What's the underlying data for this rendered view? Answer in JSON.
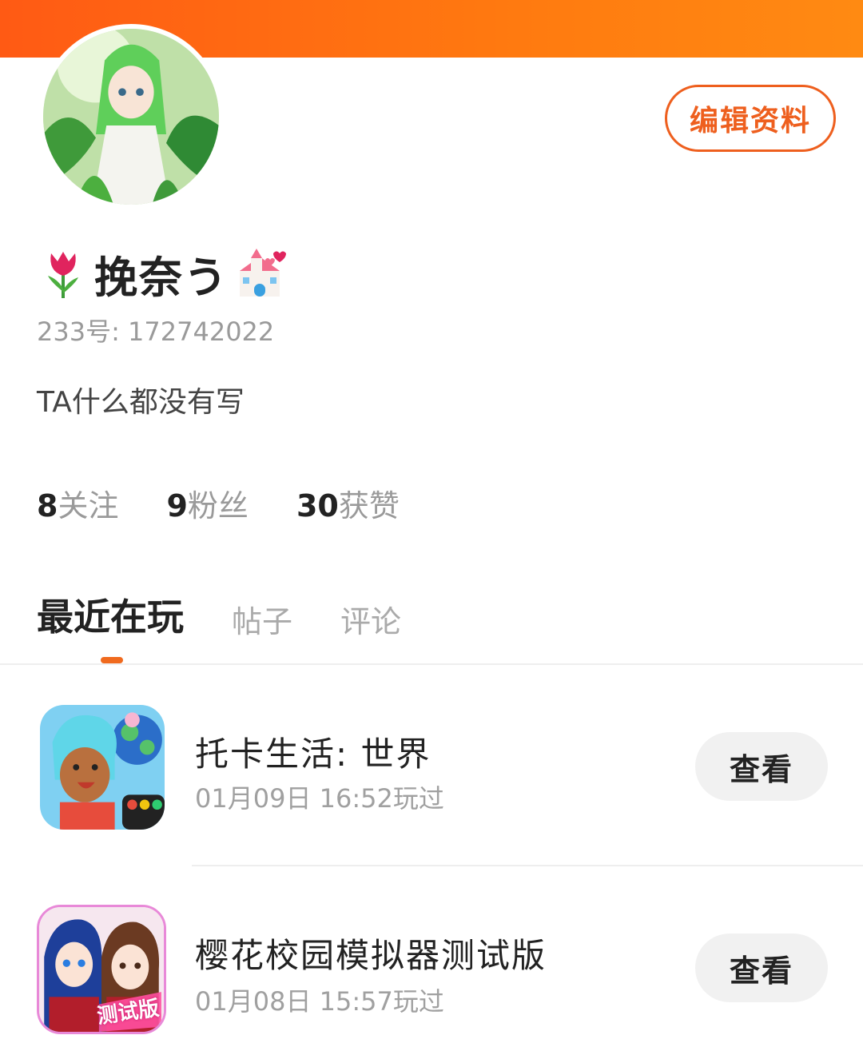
{
  "header": {
    "accent_color": "#ff6a12"
  },
  "profile": {
    "avatar_icon": "avatar-anime-girl-icon",
    "name": "挽奈う",
    "name_emoji_left": "tulip-emoji-icon",
    "name_emoji_right": "wedding-chapel-emoji-icon",
    "id_text": "233号: 172742022",
    "bio": "TA什么都没有写",
    "edit_label": "编辑资料"
  },
  "stats": [
    {
      "num": "8",
      "label": "关注"
    },
    {
      "num": "9",
      "label": "粉丝"
    },
    {
      "num": "30",
      "label": "获赞"
    }
  ],
  "tabs": [
    {
      "label": "最近在玩",
      "active": true
    },
    {
      "label": "帖子",
      "active": false
    },
    {
      "label": "评论",
      "active": false
    }
  ],
  "games": [
    {
      "title": "托卡生活: 世界",
      "time": "01月09日 16:52玩过",
      "button": "查看",
      "icon": "toca-life-world-icon"
    },
    {
      "title": "樱花校园模拟器测试版",
      "time": "01月08日 15:57玩过",
      "button": "查看",
      "icon": "sakura-school-simulator-icon",
      "icon_badge": "测试版"
    }
  ],
  "colors": {
    "accent": "#ee5f1e",
    "muted_text": "#9a9a9a",
    "button_bg": "#f1f1f1"
  }
}
